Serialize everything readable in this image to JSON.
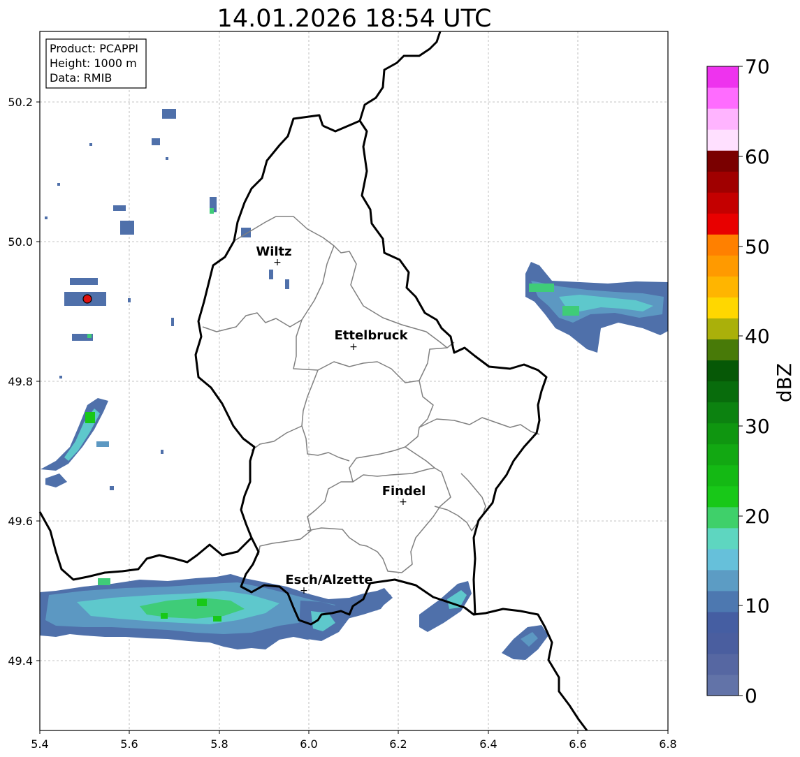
{
  "title": "14.01.2026 18:54 UTC",
  "info_box": [
    "Product: PCAPPI",
    "Height: 1000 m",
    "Data: RMIB"
  ],
  "x_ticks": [
    "5.4",
    "5.6",
    "5.8",
    "6.0",
    "6.2",
    "6.4",
    "6.6",
    "6.8"
  ],
  "y_ticks": [
    "49.4",
    "49.6",
    "49.8",
    "50.0",
    "50.2"
  ],
  "colorbar": {
    "label": "dBZ",
    "tick_labels": [
      "0",
      "10",
      "20",
      "30",
      "40",
      "50",
      "60",
      "70"
    ],
    "ticks": [
      0,
      10,
      20,
      30,
      40,
      50,
      60,
      70
    ],
    "range": [
      0,
      70
    ],
    "colors": [
      "#6273a8",
      "#5667a2",
      "#4a5e9f",
      "#455ea2",
      "#4d78b0",
      "#5c9cc4",
      "#66c0da",
      "#5ed6c0",
      "#3fd06a",
      "#18c818",
      "#14b914",
      "#12a812",
      "#0f9610",
      "#0c8210",
      "#086c0c",
      "#065806",
      "#487a08",
      "#aab00a",
      "#ffd700",
      "#ffb500",
      "#ff9a00",
      "#ff8000",
      "#e80000",
      "#c40000",
      "#a00000",
      "#7a0000",
      "#ffe0ff",
      "#ffb4ff",
      "#ff6cff",
      "#ee33ee"
    ]
  },
  "map": {
    "lon_range": [
      5.4,
      6.8
    ],
    "lat_range": [
      49.3,
      50.3
    ],
    "cities": [
      {
        "name": "Wiltz",
        "lon": 5.935,
        "lat": 49.968
      },
      {
        "name": "Ettelbruck",
        "lon": 6.104,
        "lat": 49.849
      },
      {
        "name": "Findel",
        "lon": 6.212,
        "lat": 49.628
      },
      {
        "name": "Esch/Alzette",
        "lon": 5.987,
        "lat": 49.498
      }
    ],
    "radar_site": {
      "lon": 5.506,
      "lat": 49.915,
      "color": "#dd1111"
    },
    "colors": {
      "border": "#000000",
      "district": "#808080",
      "grid": "#b0b0b0"
    }
  }
}
